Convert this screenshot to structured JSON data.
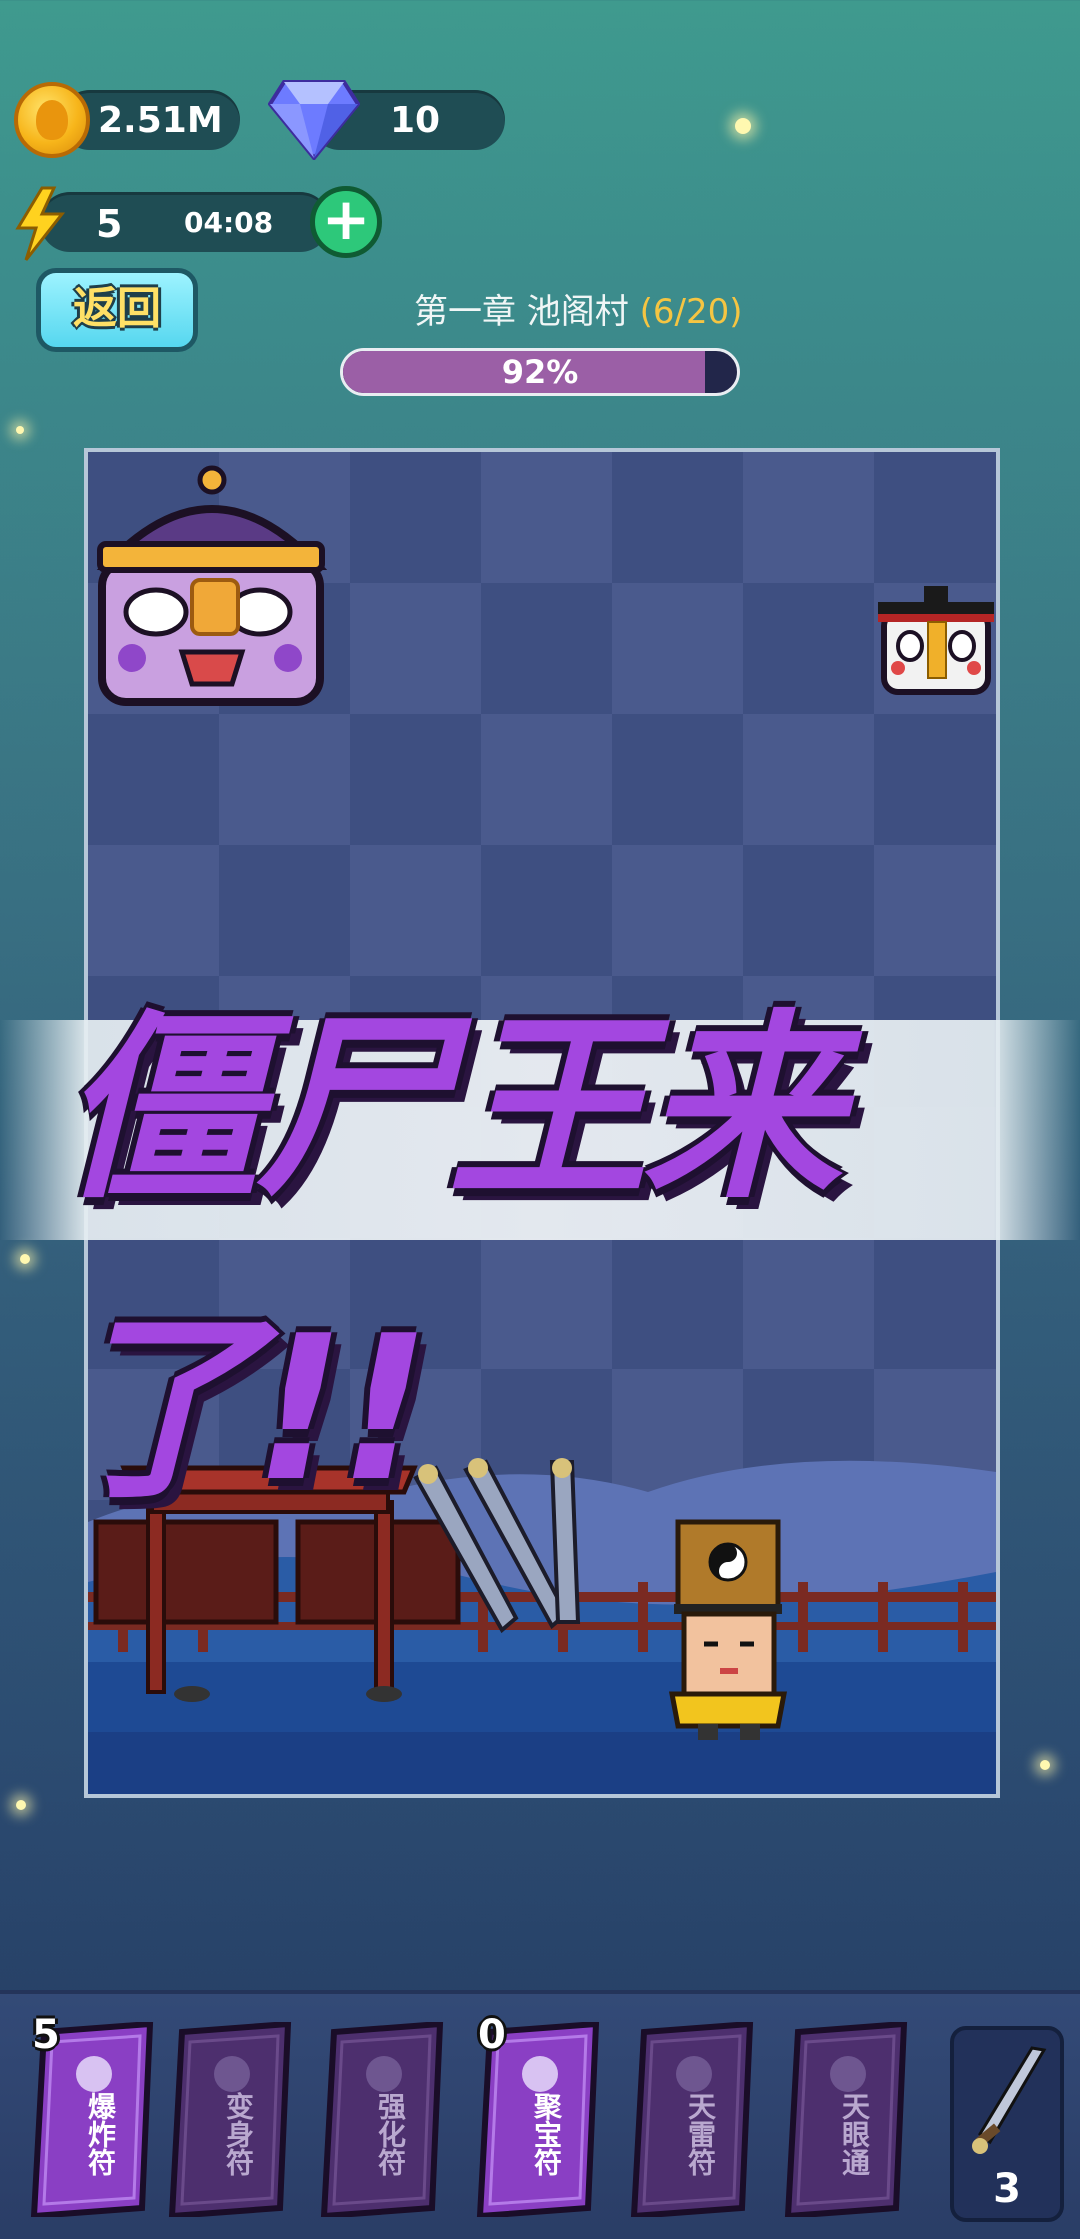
{
  "hud": {
    "coins": "2.51M",
    "gems": "10",
    "energy": "5",
    "energy_timer": "04:08",
    "add_label": "+",
    "back_label": "返回"
  },
  "level": {
    "chapter": "第一章 池阁村",
    "progress_text": "(6/20)",
    "percent_text": "92%",
    "percent_value": 0.92
  },
  "banner": {
    "text": "僵尸王来了!!"
  },
  "skills": [
    {
      "label": "爆炸符",
      "count": "5",
      "active": true
    },
    {
      "label": "变身符",
      "count": "",
      "active": false
    },
    {
      "label": "强化符",
      "count": "",
      "active": false
    },
    {
      "label": "聚宝符",
      "count": "0",
      "active": true
    },
    {
      "label": "天雷符",
      "count": "",
      "active": false
    },
    {
      "label": "天眼通",
      "count": "",
      "active": false
    }
  ],
  "weapon": {
    "count": "3"
  },
  "colors": {
    "accent": "#a347e0",
    "progress": "#9b5fa6",
    "gold": "#f5c542"
  }
}
